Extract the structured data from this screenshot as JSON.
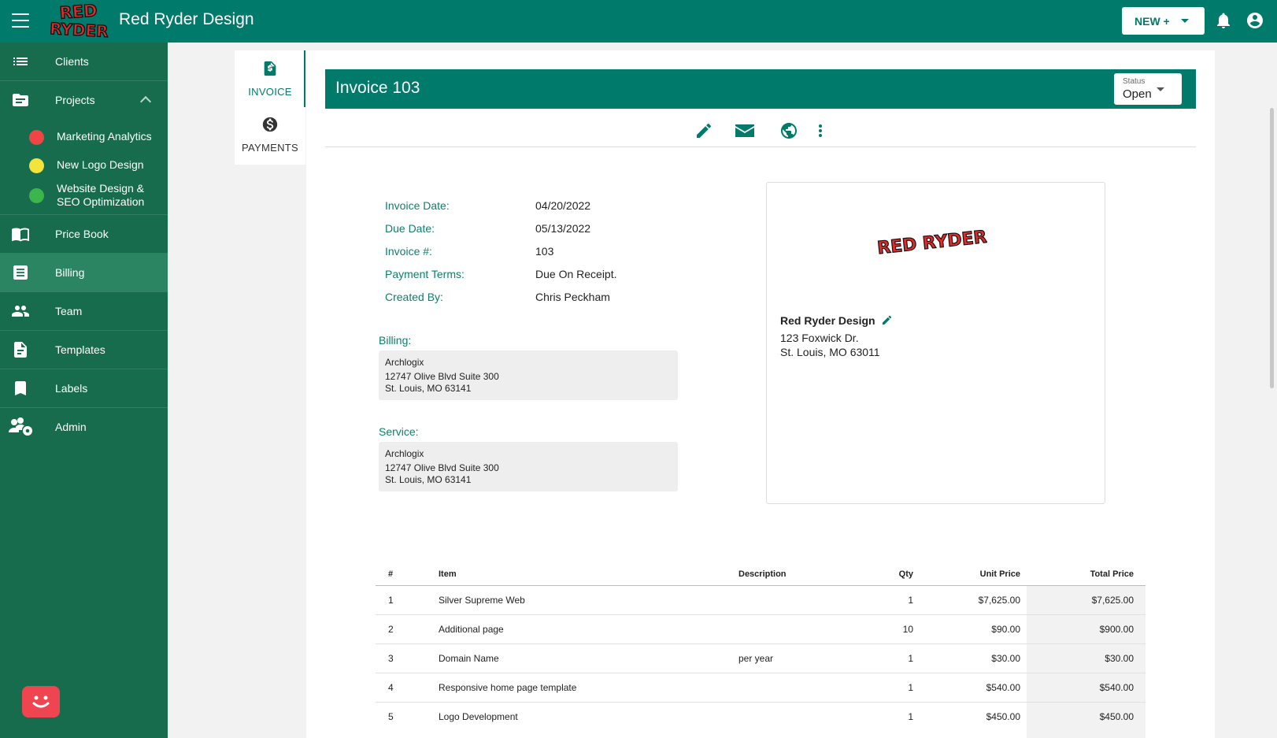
{
  "header": {
    "app_title": "Red Ryder Design",
    "logo_text": "RED RYDER",
    "new_button_label": "NEW +"
  },
  "sidebar": {
    "items": [
      {
        "label": "Clients"
      },
      {
        "label": "Projects"
      },
      {
        "label": "Price Book"
      },
      {
        "label": "Billing"
      },
      {
        "label": "Team"
      },
      {
        "label": "Templates"
      },
      {
        "label": "Labels"
      },
      {
        "label": "Admin"
      }
    ],
    "projects": [
      {
        "label": "Marketing Analytics",
        "color": "#ef4545"
      },
      {
        "label": "New Logo Design",
        "color": "#f4e33a"
      },
      {
        "label": "Website Design &\nSEO Optimization",
        "color": "#3cb54a"
      }
    ]
  },
  "tabs": {
    "invoice_label": "INVOICE",
    "payments_label": "PAYMENTS"
  },
  "invoice": {
    "title": "Invoice 103",
    "status_label": "Status",
    "status_value": "Open",
    "meta": {
      "date_label": "Invoice Date:",
      "date_value": "04/20/2022",
      "due_label": "Due Date:",
      "due_value": "05/13/2022",
      "number_label": "Invoice #:",
      "number_value": "103",
      "terms_label": "Payment Terms:",
      "terms_value": "Due On Receipt.",
      "created_label": "Created By:",
      "created_value": "Chris Peckham"
    },
    "billing": {
      "label": "Billing:",
      "name": "Archlogix",
      "street": "12747 Olive Blvd Suite 300",
      "city": "St. Louis, MO 63141"
    },
    "service": {
      "label": "Service:",
      "name": "Archlogix",
      "street": "12747 Olive Blvd Suite 300",
      "city": "St. Louis, MO 63141"
    },
    "company": {
      "logo_text": "RED RYDER",
      "name": "Red Ryder Design",
      "street": "123 Foxwick Dr.",
      "city": "St. Louis, MO 63011"
    }
  },
  "table": {
    "headers": {
      "num": "#",
      "item": "Item",
      "description": "Description",
      "qty": "Qty",
      "unit_price": "Unit Price",
      "total_price": "Total Price"
    },
    "rows": [
      {
        "num": "1",
        "item": "Silver Supreme Web",
        "description": "",
        "qty": "1",
        "unit": "$7,625.00",
        "total": "$7,625.00"
      },
      {
        "num": "2",
        "item": "Additional page",
        "description": "",
        "qty": "10",
        "unit": "$90.00",
        "total": "$900.00"
      },
      {
        "num": "3",
        "item": "Domain Name",
        "description": "per year",
        "qty": "1",
        "unit": "$30.00",
        "total": "$30.00"
      },
      {
        "num": "4",
        "item": "Responsive home page template",
        "description": "",
        "qty": "1",
        "unit": "$540.00",
        "total": "$540.00"
      },
      {
        "num": "5",
        "item": "Logo Development",
        "description": "",
        "qty": "1",
        "unit": "$450.00",
        "total": "$450.00"
      }
    ]
  },
  "colors": {
    "primary": "#007a6b",
    "sidebar": "#176c4e",
    "brand_red": "#ef4550"
  }
}
